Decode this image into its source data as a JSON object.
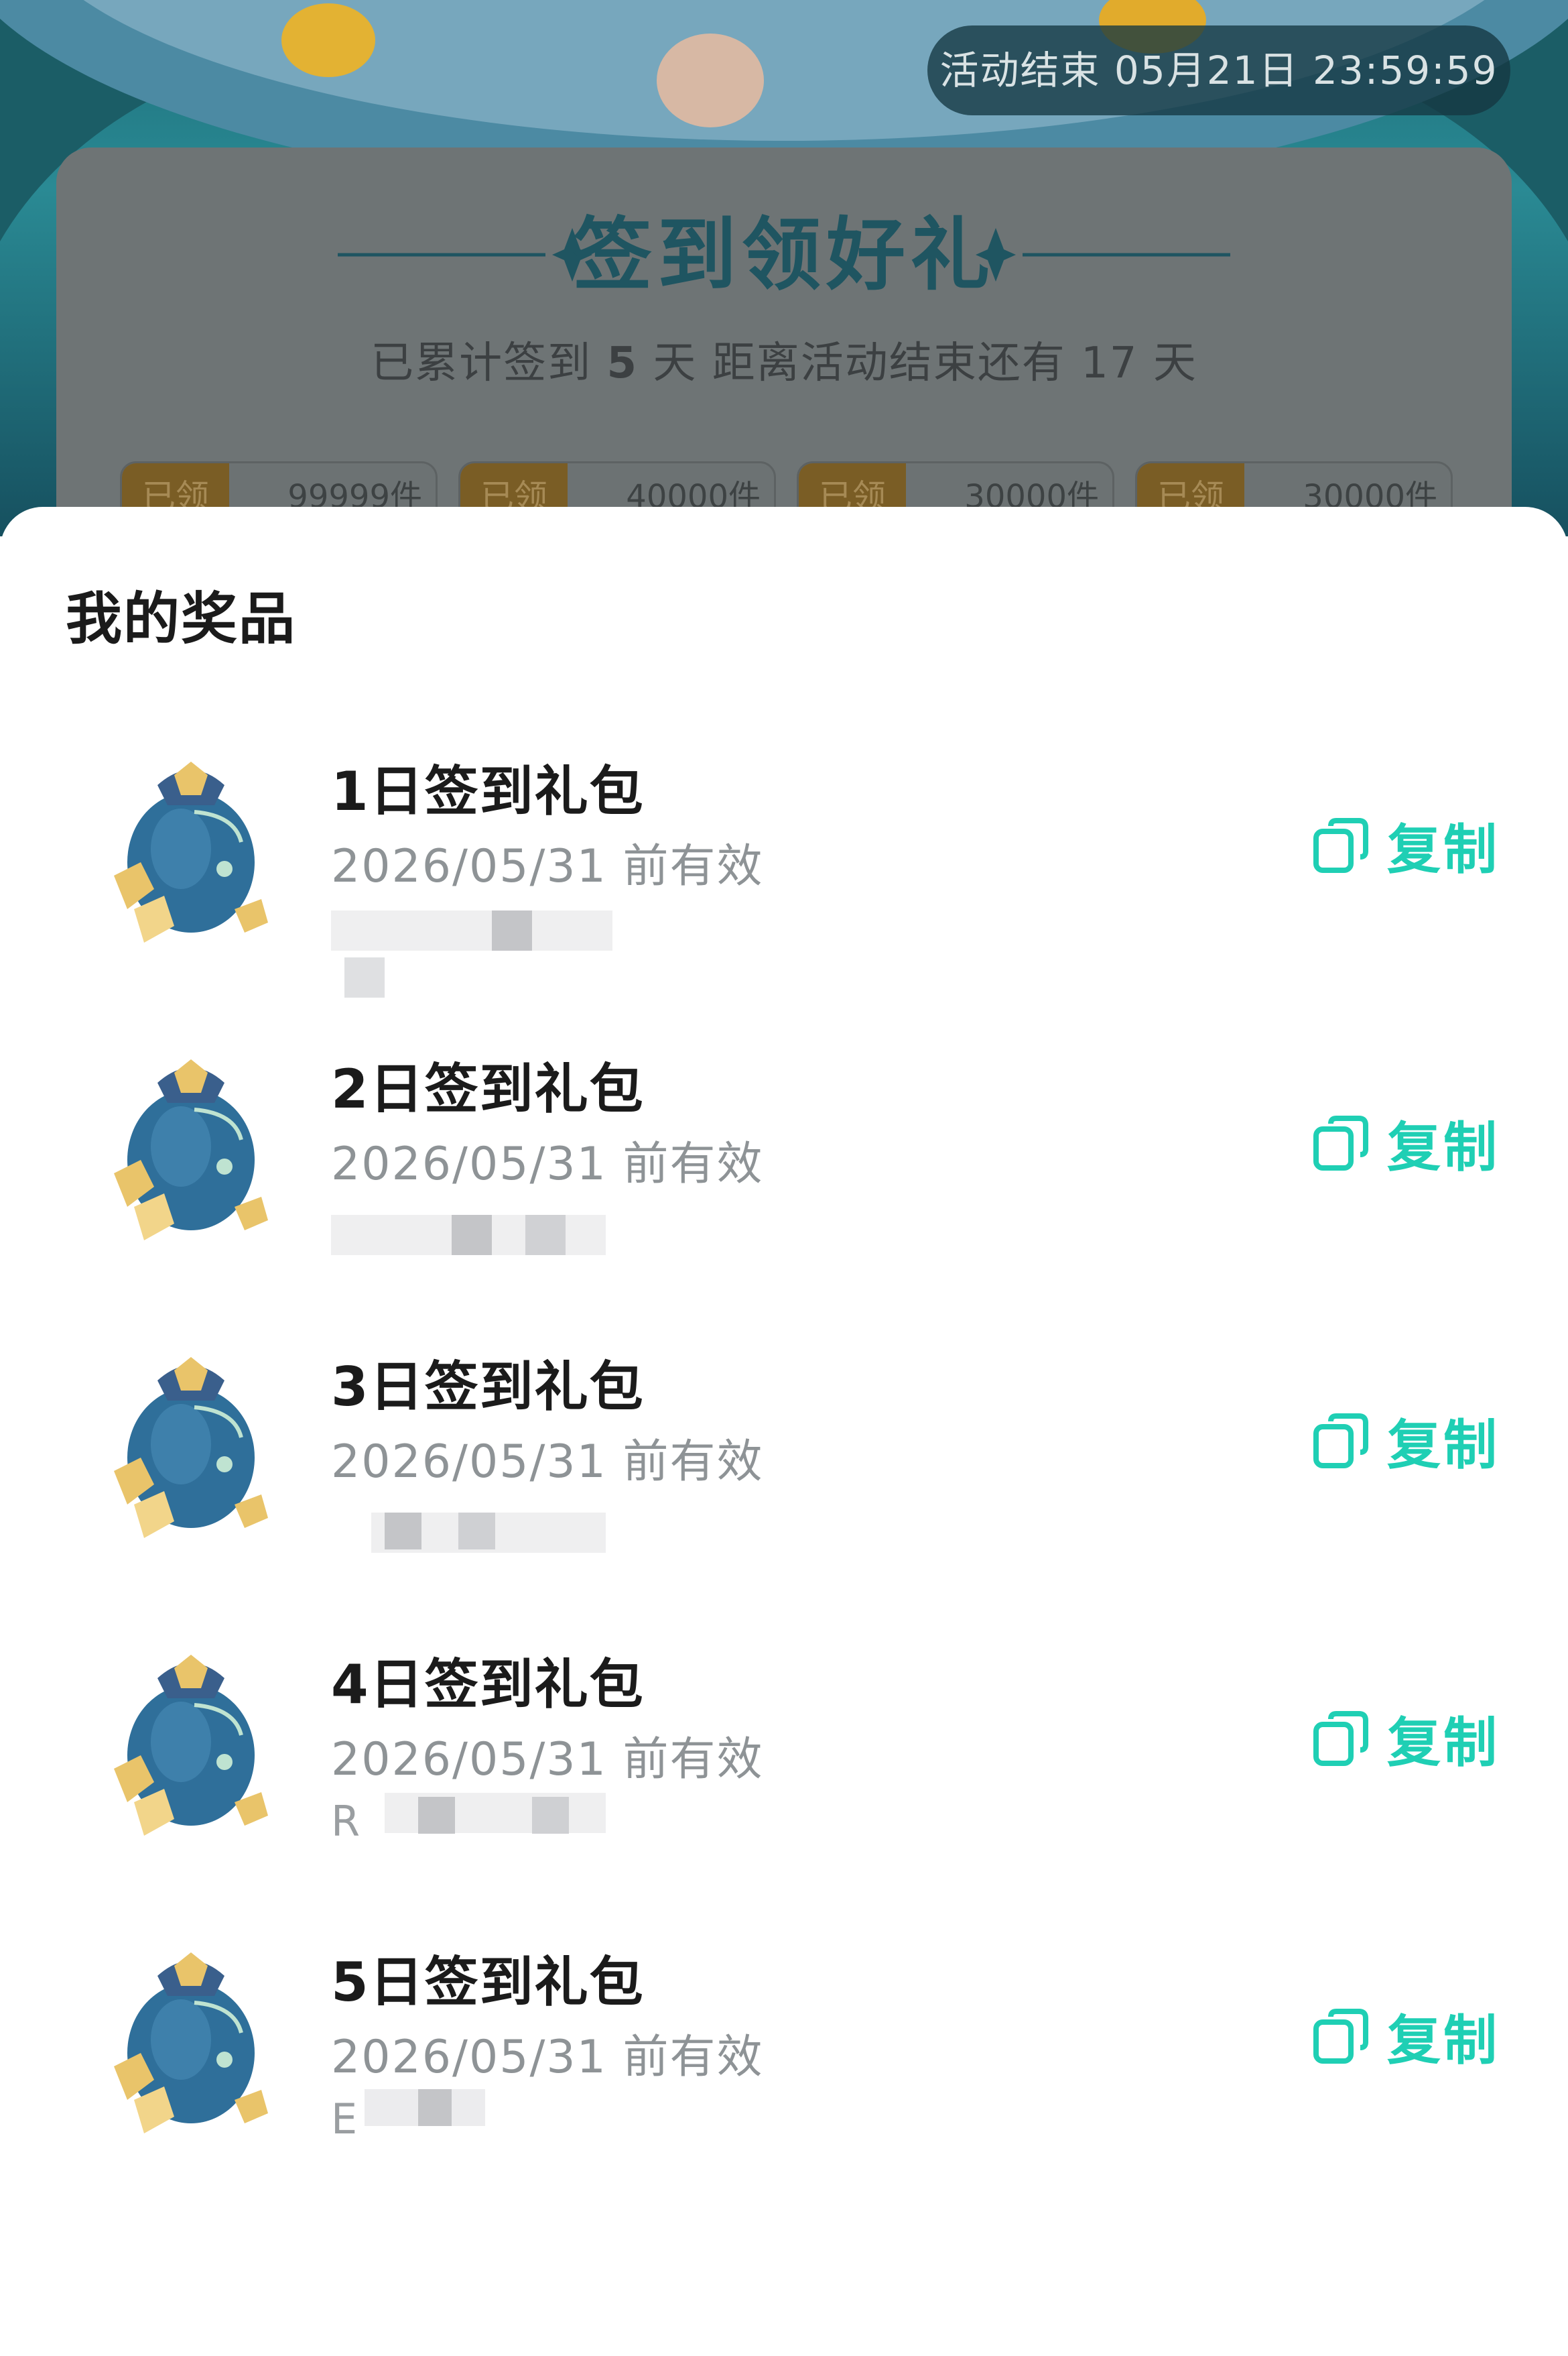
{
  "background": {
    "countdown": "活动结束 05月21日 23:59:59",
    "card": {
      "title": "签到领好礼",
      "subtitle_prefix": "已累计签到",
      "signed_days": "5",
      "subtitle_mid": "天  距离活动结束还有",
      "remaining_days": "17",
      "subtitle_suffix": "天",
      "prizes": [
        {
          "tag": "已领",
          "count": "99999件"
        },
        {
          "tag": "已领",
          "count": "40000件"
        },
        {
          "tag": "已领",
          "count": "30000件"
        },
        {
          "tag": "已领",
          "count": "30000件"
        }
      ]
    }
  },
  "sheet": {
    "title": "我的奖品",
    "copy_label": "复制",
    "items": [
      {
        "name": "1日签到礼包",
        "expiry": "2026/05/31 前有效",
        "code_visible": ""
      },
      {
        "name": "2日签到礼包",
        "expiry": "2026/05/31 前有效",
        "code_visible": ""
      },
      {
        "name": "3日签到礼包",
        "expiry": "2026/05/31 前有效",
        "code_visible": ""
      },
      {
        "name": "4日签到礼包",
        "expiry": "2026/05/31 前有效",
        "code_visible": "R"
      },
      {
        "name": "5日签到礼包",
        "expiry": "2026/05/31 前有效",
        "code_visible": "E"
      }
    ]
  },
  "colors": {
    "accent": "#1fcfb4",
    "title_text": "#1b1b1b",
    "secondary_text": "#8e9396"
  },
  "icons": [
    "gift-bag-icon",
    "copy-icon"
  ]
}
